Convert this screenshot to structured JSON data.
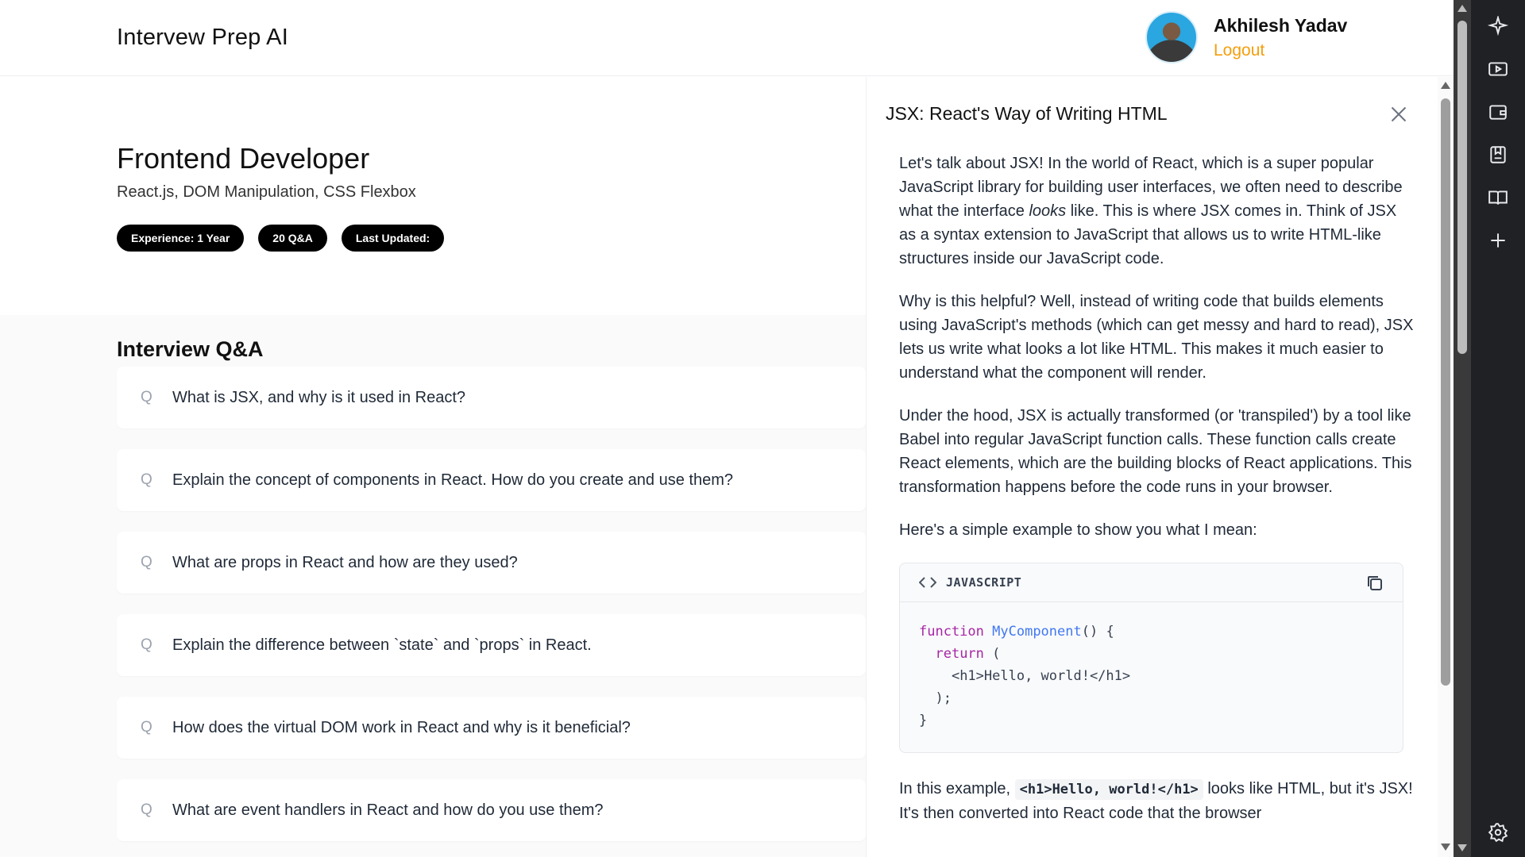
{
  "header": {
    "app_title": "Intervew Prep AI",
    "user_name": "Akhilesh Yadav",
    "logout_label": "Logout"
  },
  "hero": {
    "role": "Frontend Developer",
    "topics": "React.js, DOM Manipulation, CSS Flexbox",
    "pills": [
      "Experience: 1 Year",
      "20 Q&A",
      "Last Updated:"
    ]
  },
  "qa": {
    "heading": "Interview Q&A",
    "q_marker": "Q",
    "items": [
      "What is JSX, and why is it used in React?",
      "Explain the concept of components in React. How do you create and use them?",
      "What are props in React and how are they used?",
      "Explain the difference between `state` and `props` in React.",
      "How does the virtual DOM work in React and why is it beneficial?",
      "What are event handlers in React and how do you use them?"
    ]
  },
  "drawer": {
    "title": "JSX: React's Way of Writing HTML",
    "p1_a": "Let's talk about JSX! In the world of React, which is a super popular JavaScript library for building user interfaces, we often need to describe what the interface ",
    "p1_em": "looks",
    "p1_b": " like. This is where JSX comes in. Think of JSX as a syntax extension to JavaScript that allows us to write HTML-like structures inside our JavaScript code.",
    "p2": "Why is this helpful? Well, instead of writing code that builds elements using JavaScript's methods (which can get messy and hard to read), JSX lets us write what looks a lot like HTML. This makes it much easier to understand what the component will render.",
    "p3": "Under the hood, JSX is actually transformed (or 'transpiled') by a tool like Babel into regular JavaScript function calls. These function calls create React elements, which are the building blocks of React applications. This transformation happens before the code runs in your browser.",
    "p4": "Here's a simple example to show you what I mean:",
    "code_lang": "JAVASCRIPT",
    "code": {
      "kw_function": "function",
      "fn_name": "MyComponent",
      "sig_tail": "() {",
      "kw_return": "return",
      "open_paren": " (",
      "jsx_line": "<h1>Hello, world!</h1>",
      "close": ");",
      "brace": "}"
    },
    "p5_a": "In this example, ",
    "p5_code": "<h1>Hello, world!</h1>",
    "p5_b": " looks like HTML, but it's JSX! It's then converted into React code that the browser"
  },
  "side_panel": {
    "icons": [
      "sparkle-icon",
      "video-icon",
      "wallet-icon",
      "bookmark-icon",
      "book-icon",
      "plus-icon",
      "settings-icon"
    ]
  },
  "colors": {
    "accent_logout": "#f59e0b",
    "pill_bg": "#000000",
    "keyword": "#a626a4",
    "function_name": "#4078f2"
  }
}
